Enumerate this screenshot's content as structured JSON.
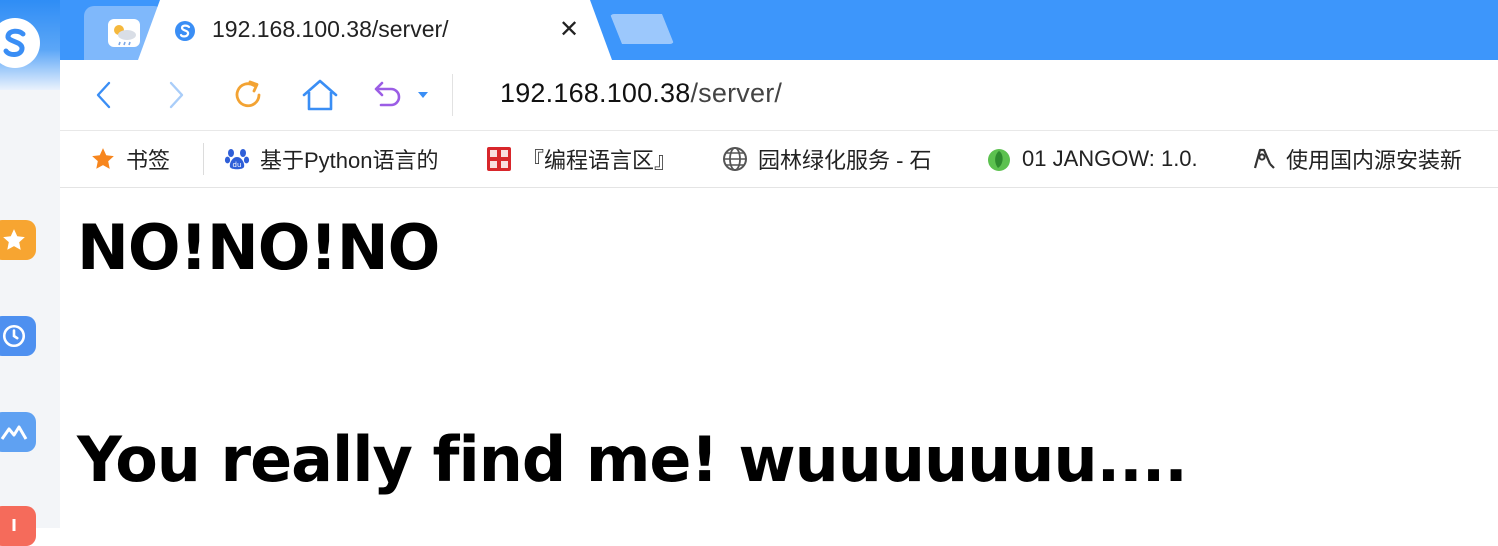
{
  "colors": {
    "tabbar_bg": "#3d96fb",
    "accent_blue": "#3a8ef5",
    "reload_orange": "#f3a333",
    "undo_purple": "#9b5de5"
  },
  "sidebar": {
    "logo_icon": "sogou-logo-icon",
    "items": [
      {
        "icon": "star-icon",
        "color": "#f7a531"
      },
      {
        "icon": "clock-icon",
        "color": "#4e90f0"
      },
      {
        "icon": "mountain-icon",
        "color": "#5fa1f2"
      },
      {
        "icon": "app-icon",
        "color": "#f56b5b"
      }
    ]
  },
  "tabs": {
    "weather_icon": "weather-icon",
    "active": {
      "title": "192.168.100.38/server/",
      "close_label": "✕"
    }
  },
  "navbar": {
    "address_host": "192.168.100.38",
    "address_path": "/server/"
  },
  "bookmarks": {
    "bookmark_label": "书签",
    "items": [
      {
        "label": "基于Python语言的",
        "icon": "baidu-paw-icon"
      },
      {
        "label": "『编程语言区』",
        "icon": "pojie-seal-icon"
      },
      {
        "label": "园林绿化服务 - 石",
        "icon": "globe-icon"
      },
      {
        "label": "01 JANGOW: 1.0.",
        "icon": "green-leaf-icon"
      },
      {
        "label": "使用国内源安装新",
        "icon": "pen-tool-icon"
      }
    ]
  },
  "page": {
    "heading1": "NO!NO!NO",
    "heading2": "You really find me! wuuuuuuu...."
  }
}
